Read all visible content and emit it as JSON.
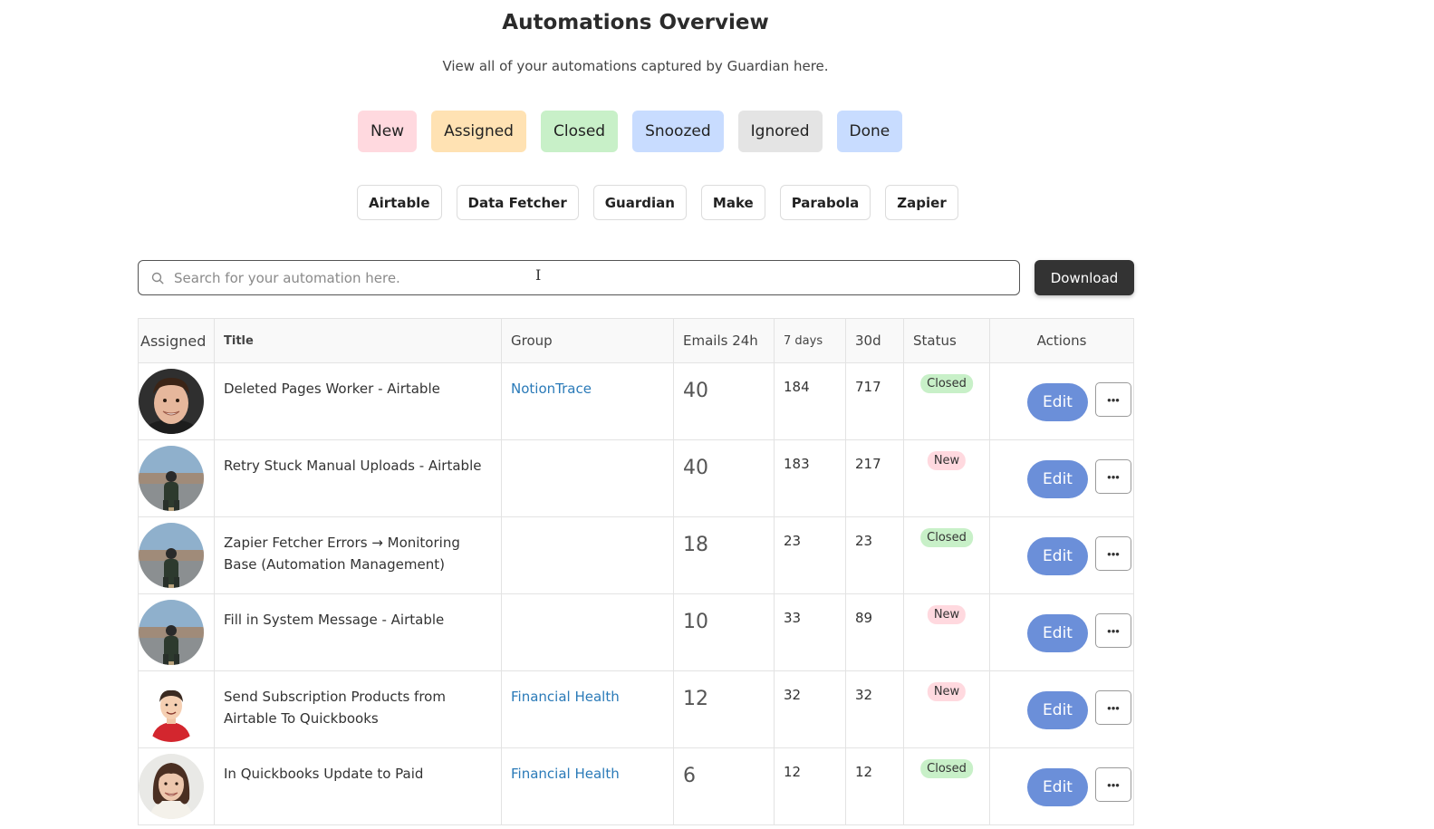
{
  "page": {
    "title": "Automations Overview",
    "subtitle": "View all of your automations captured by Guardian here."
  },
  "status_filters": [
    {
      "label": "New",
      "color": "#ffd9df"
    },
    {
      "label": "Assigned",
      "color": "#ffe2b3"
    },
    {
      "label": "Closed",
      "color": "#c8f0c8"
    },
    {
      "label": "Snoozed",
      "color": "#c8dcff"
    },
    {
      "label": "Ignored",
      "color": "#e4e4e4"
    },
    {
      "label": "Done",
      "color": "#c8dcff"
    }
  ],
  "source_filters": [
    "Airtable",
    "Data Fetcher",
    "Guardian",
    "Make",
    "Parabola",
    "Zapier"
  ],
  "search": {
    "placeholder": "Search for your automation here.",
    "value": "",
    "icon": "search-icon"
  },
  "download": {
    "label": "Download"
  },
  "table": {
    "headers": {
      "assigned": "Assigned",
      "title": "Title",
      "group": "Group",
      "emails": "Emails 24h",
      "days7": "7 days",
      "d30": "30d",
      "status": "Status",
      "actions": "Actions"
    },
    "status_colors": {
      "Closed": "#c8f0c8",
      "New": "#ffd9df"
    },
    "rows": [
      {
        "avatar": "avatar-man-smiling",
        "title": "Deleted Pages Worker - Airtable",
        "group": "NotionTrace",
        "emails": "40",
        "days7": "184",
        "d30": "717",
        "status": "Closed",
        "edit": "Edit",
        "more": "•••"
      },
      {
        "avatar": "avatar-man-desert",
        "title": "Retry Stuck Manual Uploads - Airtable",
        "group": "",
        "emails": "40",
        "days7": "183",
        "d30": "217",
        "status": "New",
        "edit": "Edit",
        "more": "•••"
      },
      {
        "avatar": "avatar-man-desert",
        "title": "Zapier Fetcher Errors → Monitoring Base (Automation Management)",
        "group": "",
        "emails": "18",
        "days7": "23",
        "d30": "23",
        "status": "Closed",
        "edit": "Edit",
        "more": "•••"
      },
      {
        "avatar": "avatar-man-desert",
        "title": "Fill in System Message - Airtable",
        "group": "",
        "emails": "10",
        "days7": "33",
        "d30": "89",
        "status": "New",
        "edit": "Edit",
        "more": "•••"
      },
      {
        "avatar": "avatar-cartoon-man",
        "title": "Send Subscription Products from Airtable To Quickbooks",
        "group": "Financial Health",
        "emails": "12",
        "days7": "32",
        "d30": "32",
        "status": "New",
        "edit": "Edit",
        "more": "•••"
      },
      {
        "avatar": "avatar-woman",
        "title": "In Quickbooks Update to Paid",
        "group": "Financial Health",
        "emails": "6",
        "days7": "12",
        "d30": "12",
        "status": "Closed",
        "edit": "Edit",
        "more": "•••"
      }
    ]
  }
}
